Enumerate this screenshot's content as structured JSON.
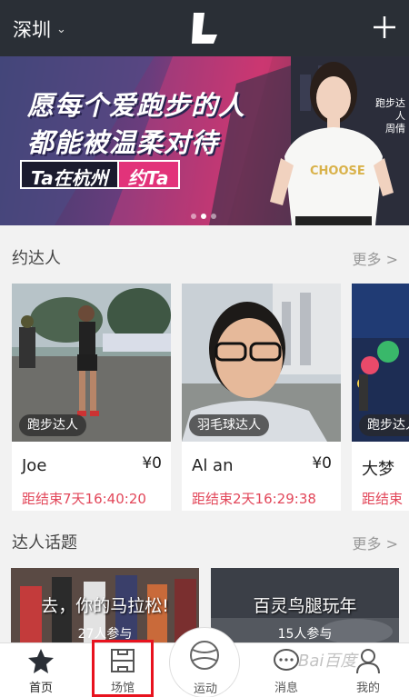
{
  "header": {
    "city": "深圳",
    "chevron_icon": "chevron-down-icon",
    "logo_icon": "app-logo-L",
    "add_icon": "plus-icon"
  },
  "banner": {
    "line1": "愿每个爱跑步的人",
    "line2": "都能被温柔对待",
    "tag_part1": "Ta在杭州",
    "tag_part2": "约Ta",
    "side_label1": "跑步达人",
    "side_label2": "周倩",
    "shirt_text": "CHOOSE",
    "dots": 3,
    "active_dot": 2
  },
  "section_meet": {
    "title": "约达人",
    "more": "更多 >"
  },
  "cards": [
    {
      "badge": "跑步达人",
      "name": "Joe",
      "price": "¥0",
      "countdown": "距结束7天16:40:20"
    },
    {
      "badge": "羽毛球达人",
      "name": "Al an",
      "price": "¥0",
      "countdown": "距结束2天16:29:38"
    },
    {
      "badge": "跑步达人",
      "name": "大梦",
      "price": "",
      "countdown": "距结束"
    }
  ],
  "section_topics": {
    "title": "达人话题",
    "more": "更多 >"
  },
  "topics": [
    {
      "title": "去，你的马拉松!",
      "count": "27人参与"
    },
    {
      "title": "百灵鸟腿玩年",
      "count": "15人参与"
    }
  ],
  "tabbar": {
    "home": "首页",
    "venue": "场馆",
    "sport": "运动",
    "message": "消息",
    "mine": "我的"
  },
  "watermark": "Bai百度"
}
